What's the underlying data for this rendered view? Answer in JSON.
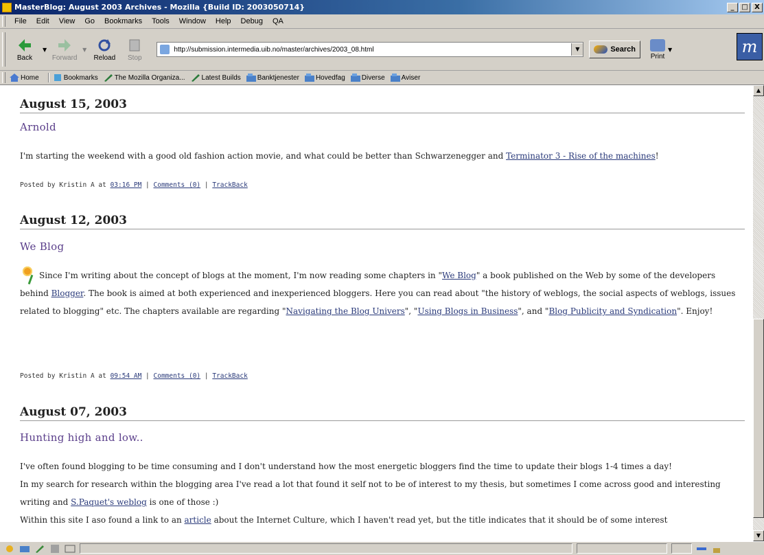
{
  "window": {
    "title": "MasterBlog: August 2003 Archives - Mozilla {Build ID: 2003050714}",
    "controls": [
      "_",
      "□",
      "X"
    ]
  },
  "menu": [
    "File",
    "Edit",
    "View",
    "Go",
    "Bookmarks",
    "Tools",
    "Window",
    "Help",
    "Debug",
    "QA"
  ],
  "nav": {
    "back": "Back",
    "forward": "Forward",
    "reload": "Reload",
    "stop": "Stop",
    "url": "http://submission.intermedia.uib.no/master/archives/2003_08.html",
    "search": "Search",
    "print": "Print",
    "throbber": "m"
  },
  "bookmarks": [
    "Home",
    "Bookmarks",
    "The Mozilla Organiza...",
    "Latest Builds",
    "Banktjenester",
    "Hovedfag",
    "Diverse",
    "Aviser"
  ],
  "entries": [
    {
      "date": "August 15, 2003",
      "title": "Arnold",
      "body_1": "I'm starting the weekend with a good old fashion action movie, and what could be better than Schwarzenegger and ",
      "link_1": "Terminator 3 - Rise of the machines",
      "body_2": "!",
      "posted_by": "Posted by Kristin A at ",
      "time": "03:16 PM",
      "comments": "Comments (0)",
      "trackback": "TrackBack"
    },
    {
      "date": "August 12, 2003",
      "title": "We Blog",
      "body_1": "Since I'm writing about the concept of blogs at the moment, I'm now reading some chapters in \"",
      "link_1": "We Blog",
      "body_2": "\" a book published on the Web by some of the developers behind ",
      "link_2": "Blogger",
      "body_3": ". The book is aimed at both experienced and inexperienced bloggers. Here you can read about \"the history of weblogs, the social aspects of weblogs, issues related to blogging\" etc. The chapters available are regarding \"",
      "link_3": "Navigating the Blog Univers",
      "body_4": "\", \"",
      "link_4": "Using Blogs in Business",
      "body_5": "\", and \"",
      "link_5": "Blog Publicity and Syndication",
      "body_6": "\". Enjoy!",
      "posted_by": "Posted by Kristin A at ",
      "time": "09:54 AM",
      "comments": "Comments (0)",
      "trackback": "TrackBack"
    },
    {
      "date": "August 07, 2003",
      "title": "Hunting high and low..",
      "line_1": "I've often found blogging to be time consuming and I don't understand how the most energetic bloggers find the time to update their blogs 1-4 times a day!",
      "line_2": "In my search for research within the blogging area I've read a lot that found it self not to be of interest to my thesis, but sometimes I come across good and interesting writing and ",
      "link_1": "S.Paquet's weblog",
      "line_2b": " is one of those :)",
      "line_3": "Within this site I aso found a link to an ",
      "link_2": "article",
      "line_3b": " about the Internet Culture, which I haven't read yet, but the title indicates that it should be of some interest"
    }
  ],
  "separator": " | "
}
